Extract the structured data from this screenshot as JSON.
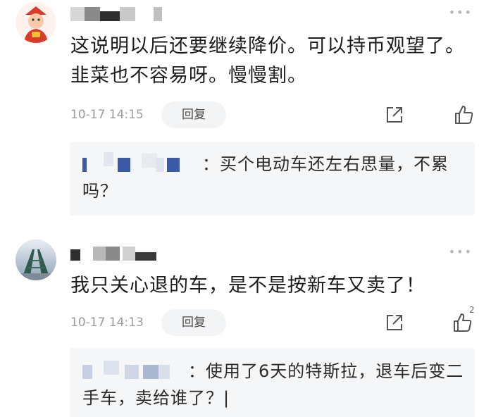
{
  "comments": [
    {
      "body": "这说明以后还要继续降价。可以持币观望了。韭菜也不容易呀。慢慢割。",
      "time": "10-17 14:15",
      "reply_label": "回复",
      "likes": "",
      "reply": {
        "text": "：买个电动车还左右思量，不累吗？"
      }
    },
    {
      "body": "我只关心退的车，是不是按新车又卖了！",
      "time": "10-17 14:13",
      "reply_label": "回复",
      "likes": "2",
      "reply": {
        "text": "：使用了6天的特斯拉，退车后变二手车，卖给谁了？|"
      }
    }
  ],
  "icons": {
    "more": "more-dots-icon",
    "share": "share-external-icon",
    "like": "thumbs-up-icon"
  },
  "colors": {
    "reply_bg": "#f5f6f8",
    "pill_bg": "#f3f4f6",
    "muted": "#9c9c9c"
  }
}
